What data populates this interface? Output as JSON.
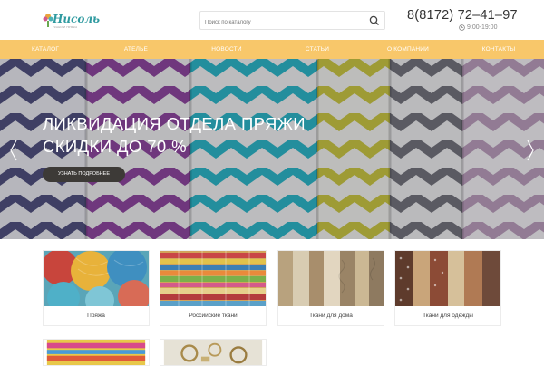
{
  "header": {
    "logo_text": "Нисоль",
    "logo_sub": "ТКАНИ И ПРЯЖА",
    "search_placeholder": "Поиск по каталогу",
    "phone": "8(8172) 72–41–97",
    "hours": "9:00-19:00"
  },
  "nav": [
    "КАТАЛОГ",
    "АТЕЛЬЕ",
    "НОВОСТИ",
    "СТАТЬИ",
    "О КОМПАНИИ",
    "КОНТАКТЫ"
  ],
  "hero": {
    "title_line1": "ЛИКВИДАЦИЯ ОТДЕЛА ПРЯЖИ",
    "title_line2": "СКИДКИ ДО 70 %",
    "button": "УЗНАТЬ ПОДРОБНЕЕ"
  },
  "categories": [
    {
      "label": "Пряжа"
    },
    {
      "label": "Российские ткани"
    },
    {
      "label": "Ткани для дома"
    },
    {
      "label": "Ткани для одежды"
    },
    {
      "label": ""
    },
    {
      "label": ""
    }
  ],
  "colors": {
    "nav_bg": "#f8c76a",
    "accent": "#2f9aa0",
    "hero_button": "#3d3a37"
  },
  "icons": [
    "search-icon",
    "clock-icon",
    "chevron-left-icon",
    "chevron-right-icon"
  ]
}
